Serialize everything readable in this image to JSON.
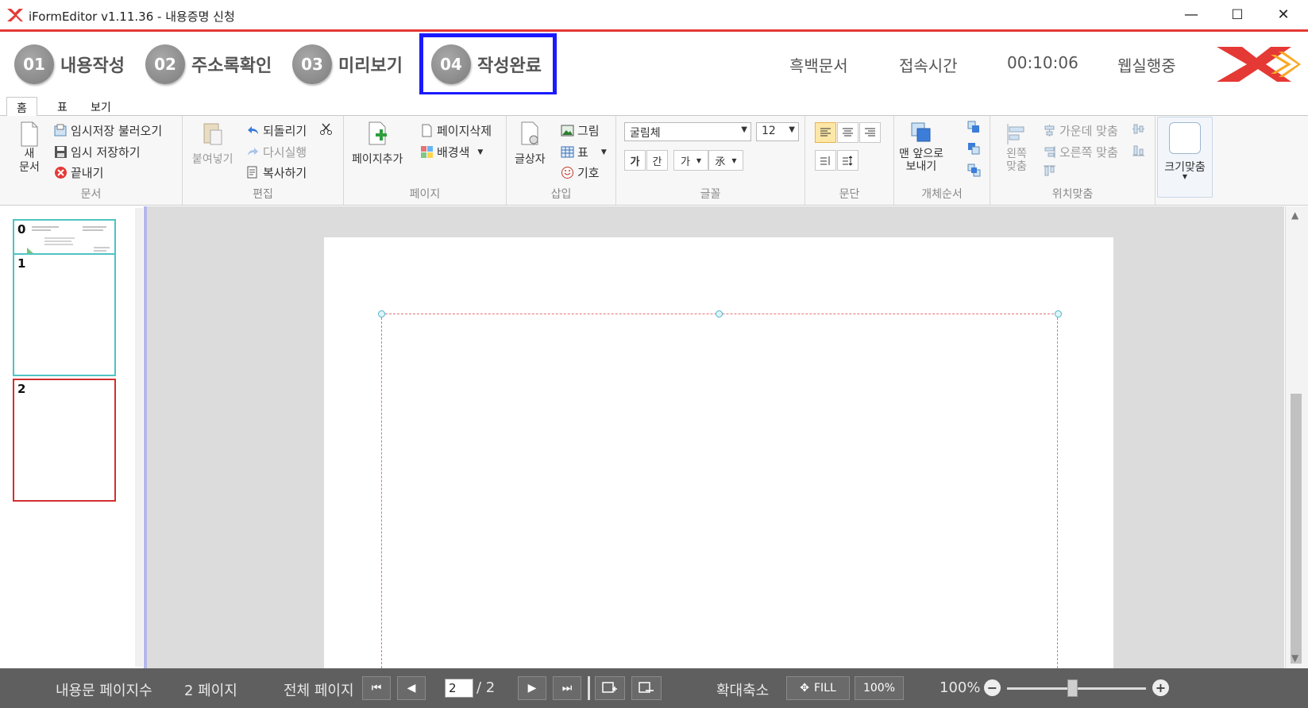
{
  "window": {
    "title": "iFormEditor v1.11.36 - 내용증명 신청",
    "minimize": "—",
    "maximize": "☐",
    "close": "✕"
  },
  "steps": [
    {
      "num": "01",
      "label": "내용작성"
    },
    {
      "num": "02",
      "label": "주소록확인"
    },
    {
      "num": "03",
      "label": "미리보기"
    },
    {
      "num": "04",
      "label": "작성완료"
    }
  ],
  "status": {
    "mono_doc": "흑백문서",
    "connect_time_label": "접속시간",
    "connect_time": "00:10:06",
    "web_run": "웹실행중"
  },
  "ribbon_tabs": [
    "홈",
    "표",
    "보기"
  ],
  "ribbon": {
    "doc": {
      "new": "새\n문서",
      "load_temp": "임시저장 불러오기",
      "save_temp": "임시 저장하기",
      "exit": "끝내기",
      "label": "문서"
    },
    "edit": {
      "paste": "붙여넣기",
      "undo": "되돌리기",
      "redo": "다시실행",
      "copy": "복사하기",
      "label": "편집"
    },
    "page": {
      "add": "페이지추가",
      "delete": "페이지삭제",
      "bg": "배경색",
      "label": "페이지"
    },
    "insert": {
      "textbox": "글상자",
      "image": "그림",
      "table": "표",
      "symbol": "기호",
      "label": "삽입"
    },
    "font": {
      "face": "굴림체",
      "size": "12",
      "bold": "가",
      "outline": "간",
      "char": "가",
      "more": "氶",
      "label": "글꼴"
    },
    "para": {
      "label": "문단"
    },
    "order": {
      "front": "맨 앞으로\n보내기",
      "label": "개체순서"
    },
    "align": {
      "left": "왼쪽\n맞춤",
      "center": "가운데 맞춤",
      "right": "오른쪽 맞춤",
      "label": "위치맞춤"
    },
    "fit": {
      "label": "크기맞춤"
    }
  },
  "thumbnails": [
    {
      "num": "0"
    },
    {
      "num": "1"
    },
    {
      "num": "2"
    }
  ],
  "statusbar": {
    "content_pages_label": "내용문 페이지수",
    "content_pages": "2 페이지",
    "total_pages_label": "전체 페이지",
    "current_page": "2",
    "total_pages": "/ 2",
    "zoom_label": "확대축소",
    "fill": "FILL",
    "hundred": "100%",
    "zoom_value": "100%"
  }
}
